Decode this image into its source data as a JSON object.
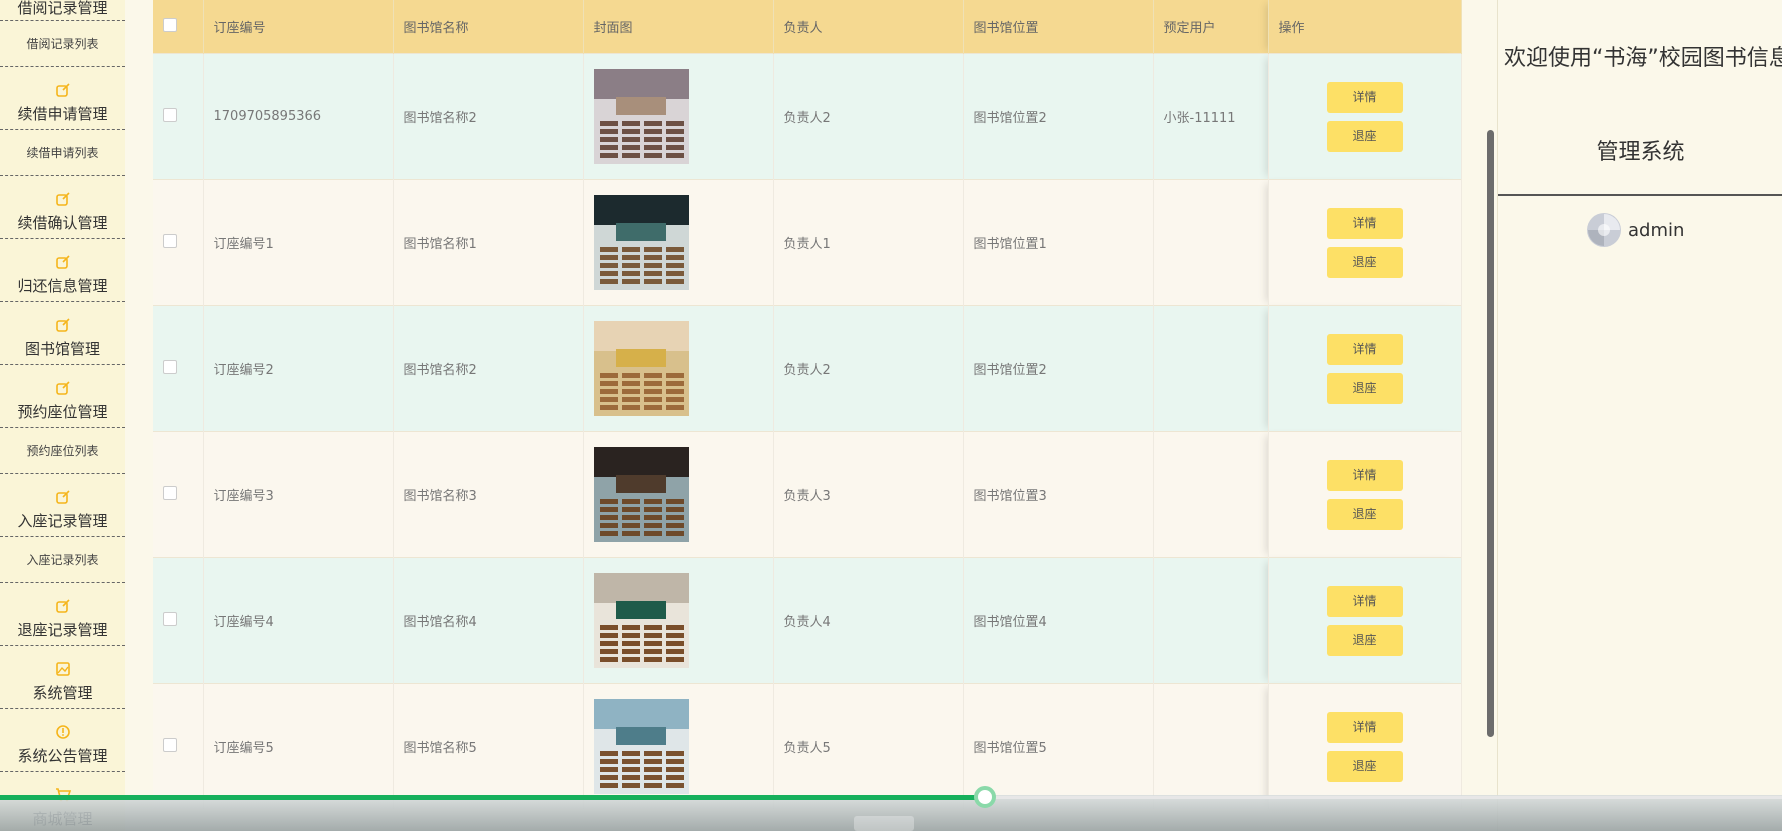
{
  "sidebar": {
    "top_partial": "借阅记录管理",
    "items": [
      {
        "type": "sub",
        "label": "借阅记录列表"
      },
      {
        "type": "group",
        "label": "续借申请管理",
        "icon": "edit-icon"
      },
      {
        "type": "sub",
        "label": "续借申请列表"
      },
      {
        "type": "group",
        "label": "续借确认管理",
        "icon": "edit-icon"
      },
      {
        "type": "group",
        "label": "归还信息管理",
        "icon": "edit-icon"
      },
      {
        "type": "group",
        "label": "图书馆管理",
        "icon": "edit-icon"
      },
      {
        "type": "group",
        "label": "预约座位管理",
        "icon": "edit-icon"
      },
      {
        "type": "sub",
        "label": "预约座位列表"
      },
      {
        "type": "group",
        "label": "入座记录管理",
        "icon": "edit-icon"
      },
      {
        "type": "sub",
        "label": "入座记录列表"
      },
      {
        "type": "group",
        "label": "退座记录管理",
        "icon": "edit-icon"
      },
      {
        "type": "group",
        "label": "系统管理",
        "icon": "image-icon"
      },
      {
        "type": "group",
        "label": "系统公告管理",
        "icon": "info-icon"
      },
      {
        "type": "group",
        "label": "商城管理",
        "icon": "cart-icon"
      }
    ]
  },
  "table": {
    "headers": [
      "订座编号",
      "图书馆名称",
      "封面图",
      "负责人",
      "图书馆位置",
      "预定用户",
      "操作"
    ],
    "detail_label": "详情",
    "leave_label": "退座",
    "rows": [
      {
        "id": "1709705895366",
        "name": "图书馆名称2",
        "manager": "负责人2",
        "location": "图书馆位置2",
        "user": "小张-11111"
      },
      {
        "id": "订座编号1",
        "name": "图书馆名称1",
        "manager": "负责人1",
        "location": "图书馆位置1",
        "user": ""
      },
      {
        "id": "订座编号2",
        "name": "图书馆名称2",
        "manager": "负责人2",
        "location": "图书馆位置2",
        "user": ""
      },
      {
        "id": "订座编号3",
        "name": "图书馆名称3",
        "manager": "负责人3",
        "location": "图书馆位置3",
        "user": ""
      },
      {
        "id": "订座编号4",
        "name": "图书馆名称4",
        "manager": "负责人4",
        "location": "图书馆位置4",
        "user": ""
      },
      {
        "id": "订座编号5",
        "name": "图书馆名称5",
        "manager": "负责人5",
        "location": "图书馆位置5",
        "user": ""
      }
    ]
  },
  "header": {
    "welcome": "欢迎使用“书海”校园图书信息",
    "system_name": "管理系统",
    "username": "admin"
  },
  "video": {
    "progress": 0.553
  }
}
